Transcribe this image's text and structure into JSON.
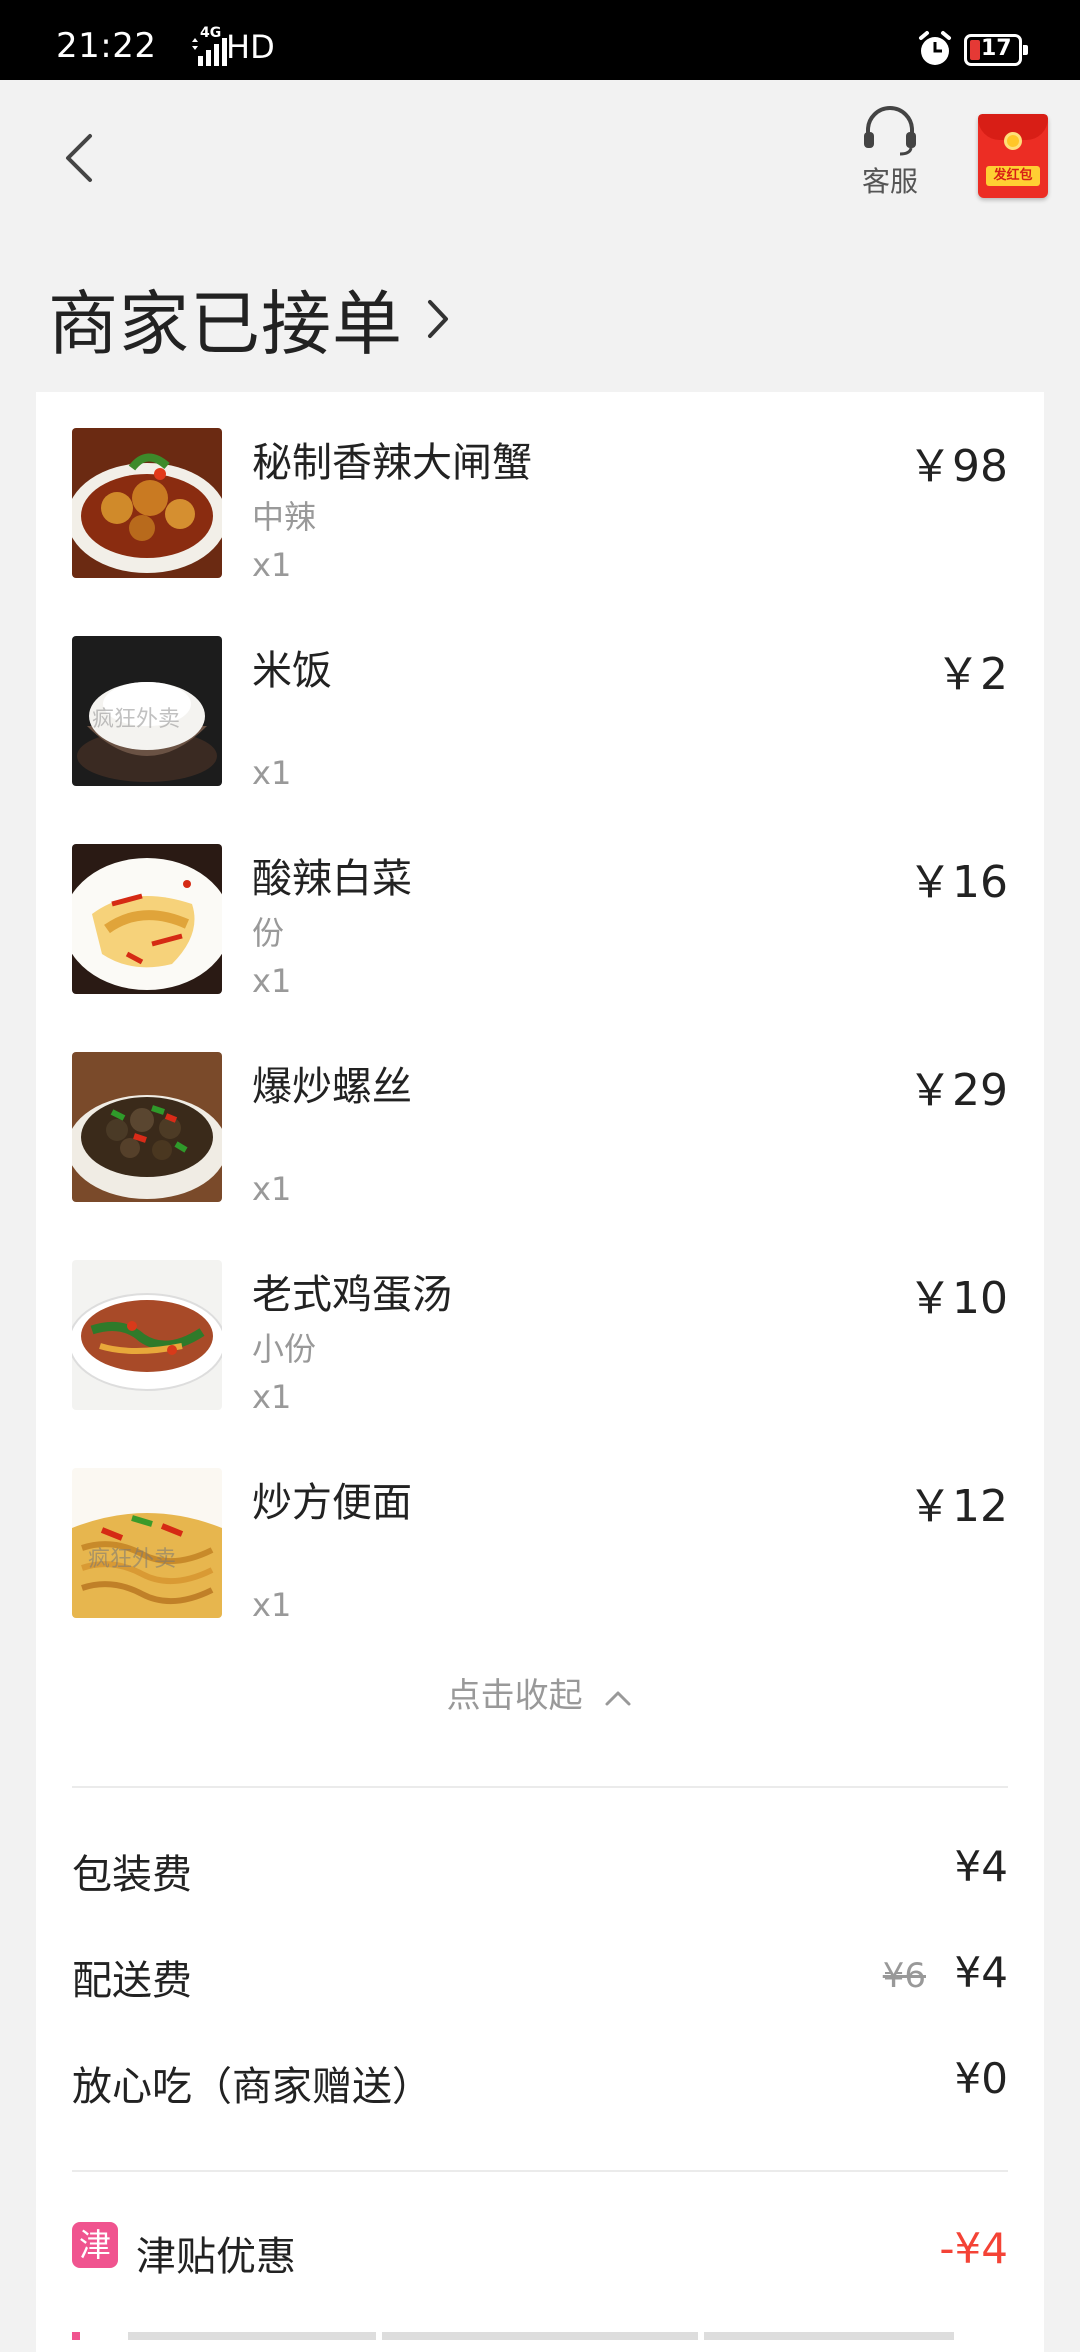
{
  "status_bar": {
    "time": "21:22",
    "network": "4G",
    "hd": "HD",
    "battery": "17"
  },
  "header": {
    "service_label": "客服",
    "hongbao_label": "发红包"
  },
  "order_status": "商家已接单",
  "items": [
    {
      "name": "秘制香辣大闸蟹",
      "spec": "中辣",
      "qty": "x1",
      "price": "￥98"
    },
    {
      "name": "米饭",
      "spec": "",
      "qty": "x1",
      "price": "￥2"
    },
    {
      "name": "酸辣白菜",
      "spec": "份",
      "qty": "x1",
      "price": "￥16"
    },
    {
      "name": "爆炒螺丝",
      "spec": "",
      "qty": "x1",
      "price": "￥29"
    },
    {
      "name": "老式鸡蛋汤",
      "spec": "小份",
      "qty": "x1",
      "price": "￥10"
    },
    {
      "name": "炒方便面",
      "spec": "",
      "qty": "x1",
      "price": "￥12"
    }
  ],
  "collapse_label": "点击收起",
  "fees": {
    "packaging": {
      "label": "包装费",
      "value": "¥4"
    },
    "delivery": {
      "label": "配送费",
      "original": "¥6",
      "value": "¥4"
    },
    "worry_free": {
      "label": "放心吃（商家赠送）",
      "value": "¥0"
    }
  },
  "subsidy": {
    "badge": "津",
    "label": "津贴优惠",
    "value": "-¥4"
  },
  "colors": {
    "accent_red": "#f44336",
    "subsidy_pink": "#f0548f",
    "hongbao_red": "#ec2d24"
  }
}
